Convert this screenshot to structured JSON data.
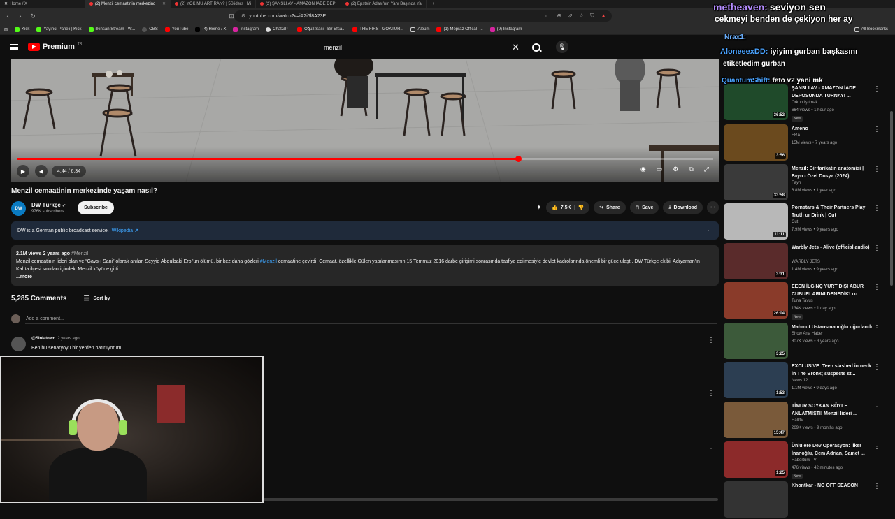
{
  "browser": {
    "tabs": [
      {
        "label": "Home / X",
        "active": false
      },
      {
        "label": "(2) Menzil cemaatinin merkezind",
        "active": true
      },
      {
        "label": "(2) YOK MU ARTIRAN? | 5Sliders | Mi",
        "active": false
      },
      {
        "label": "(2) ŞANSLI AV - AMAZON İADE DEP",
        "active": false
      },
      {
        "label": "(2) Epstein Adası'nın Yanı Başında Ya",
        "active": false
      }
    ],
    "url": "youtube.com/watch?v=iA2i6l8A23E",
    "bookmarks": [
      "Kick",
      "Yayıncı Paneli | Kick",
      "ilkinsan Stream - W...",
      "OBS",
      "YouTube",
      "(4) Home / X",
      "Instagram",
      "ChatGPT",
      "Oğuz Sasi - Bir Efsa...",
      "THE FIRST GOKTUR...",
      "Albüm",
      "(1) Mepraz Offical -...",
      "(9) Instagram"
    ],
    "all_bookmarks": "All Bookmarks"
  },
  "youtube": {
    "logo_text": "Premium",
    "logo_sup": "TR",
    "search_value": "menzil",
    "video": {
      "time": "4:44 / 6:34",
      "progress": 0.72
    },
    "title": "Menzil cemaatinin merkezinde yaşam nasıl?",
    "channel": {
      "avatar_text": "DW",
      "name": "DW Türkçe",
      "subs": "976K subscribers",
      "subscribe": "Subscribe"
    },
    "actions": {
      "likes": "7.5K",
      "share": "Share",
      "save": "Save",
      "download": "Download"
    },
    "info_banner": {
      "text": "DW is a German public broadcast service.",
      "link": "Wikipedia ↗"
    },
    "description": {
      "meta": "2.1M views  2 years ago",
      "meta_tag": "#Menzil",
      "part1": "Menzil cemaatinin lideri olan ve “Gavs-ı Sani” olarak anılan Seyyid Abdulbaki Erol'un ölümü, bir kez daha gözleri ",
      "tag": "#Menzil",
      "part2": " cemaatine çevirdi. Cemaat, özellikle Gülen yapılanmasının 15 Temmuz 2016 darbe girişimi sonrasında tasfiye edilmesiyle devlet kadrolarında önemli bir güce ulaştı. DW Türkçe ekibi, Adıyaman'ın Kahta ilçesi sınırları içindeki Menzil köyüne gitti.",
      "more": "...more"
    },
    "comments": {
      "count": "5,285 Comments",
      "sort": "Sort by",
      "add_placeholder": "Add a comment...",
      "first": {
        "author": "@Sinlatown",
        "time": "2 years ago",
        "text": "Ben bu senaryoyu bir yerden hatırlıyorum."
      }
    },
    "sidebar": [
      {
        "title": "ŞANSLI AV - AMAZON İADE DEPOSUNDA TURNAYI ...",
        "channel": "Orkun Işıtmak",
        "meta": "664 views • 1 hour ago",
        "duration": "36:52",
        "new": "New",
        "bg": "#1f4a2a"
      },
      {
        "title": "Ameno",
        "channel": "ERA",
        "meta": "15M views • 7 years ago",
        "duration": "3:56",
        "new": "",
        "bg": "#6b4a1e"
      },
      {
        "title": "Menzil: Bir tarikatın anatomisi | Fayn - Özel Dosya (2024)",
        "channel": "Fayn",
        "meta": "6.8M views • 1 year ago",
        "duration": "33:58",
        "new": "",
        "bg": "#3a3a3a"
      },
      {
        "title": "Pornstars & Their Partners Play Truth or Drink | Cut",
        "channel": "Cut",
        "meta": "7.9M views • 9 years ago",
        "duration": "11:11",
        "new": "",
        "bg": "#b8b8b8"
      },
      {
        "title": "Warbly Jets - Alive (official audio)",
        "channel": "WARBLY JETS",
        "meta": "1.4M views • 9 years ago",
        "duration": "3:31",
        "new": "",
        "bg": "#5a2b2b"
      },
      {
        "title": "EEEN İLGİNÇ YURT DIŞI ABUR CUBURLARINI DENEDİK! ıxı",
        "channel": "Tuna Tavus",
        "meta": "134K views • 1 day ago",
        "duration": "26:04",
        "new": "New",
        "bg": "#8a3b2a"
      },
      {
        "title": "Mahmut Ustaosmanoğlu uğurlandı",
        "channel": "Show Ana Haber",
        "meta": "807K views • 3 years ago",
        "duration": "3:25",
        "new": "",
        "bg": "#3c5a3a"
      },
      {
        "title": "EXCLUSIVE: Teen slashed in neck in The Bronx; suspects st...",
        "channel": "News 12",
        "meta": "1.1M views • 9 days ago",
        "duration": "1:53",
        "new": "",
        "bg": "#2c3e52"
      },
      {
        "title": "TİMUR SOYKAN BÖYLE ANLATMIŞTI! Menzil lideri ...",
        "channel": "Halktv",
        "meta": "269K views • 9 months ago",
        "duration": "15:47",
        "new": "",
        "bg": "#7a5a3a"
      },
      {
        "title": "Ünlülere Dev Operasyon: İlker İnanoğlu, Cem Adrian, Samet ...",
        "channel": "Habertürk TV",
        "meta": "476 views • 42 minutes ago",
        "duration": "1:25",
        "new": "New",
        "bg": "#8c2a2a"
      },
      {
        "title": "Khontkar - NO OFF SEASON",
        "channel": "",
        "meta": "",
        "duration": "",
        "new": "",
        "bg": "#333"
      }
    ]
  },
  "chat": [
    {
      "user": "metheaven:",
      "msg": "seviyon sen",
      "ucolor": "#b48cff"
    },
    {
      "user": "",
      "msg": "cekmeyi benden de çekiyon her ay",
      "ucolor": "#fff"
    },
    {
      "user": "Nrax1:",
      "msg": "",
      "ucolor": "#6ab0ff"
    },
    {
      "user": "AloneeexDD:",
      "msg": "iyiyim gurban başkasını",
      "ucolor": "#4aa3ff"
    },
    {
      "user": "",
      "msg": "etiketledim gurban",
      "ucolor": "#fff"
    },
    {
      "user": "QuantumShift:",
      "msg": "fetö v2 yani mk",
      "ucolor": "#4aa3ff"
    }
  ]
}
